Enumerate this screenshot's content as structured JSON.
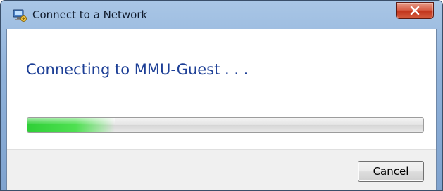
{
  "window": {
    "title": "Connect to a Network",
    "icon": "network-icon",
    "close_icon": "close-x-icon"
  },
  "main": {
    "heading": "Connecting to MMU-Guest . . ."
  },
  "progress": {
    "value_percent": 22,
    "indeterminate": true
  },
  "footer": {
    "cancel_label": "Cancel"
  },
  "colors": {
    "heading_text": "#1d3f96",
    "progress_green": "#2fcf37",
    "close_red": "#c2361e",
    "titlebar_blue": "#8fb1d9"
  }
}
